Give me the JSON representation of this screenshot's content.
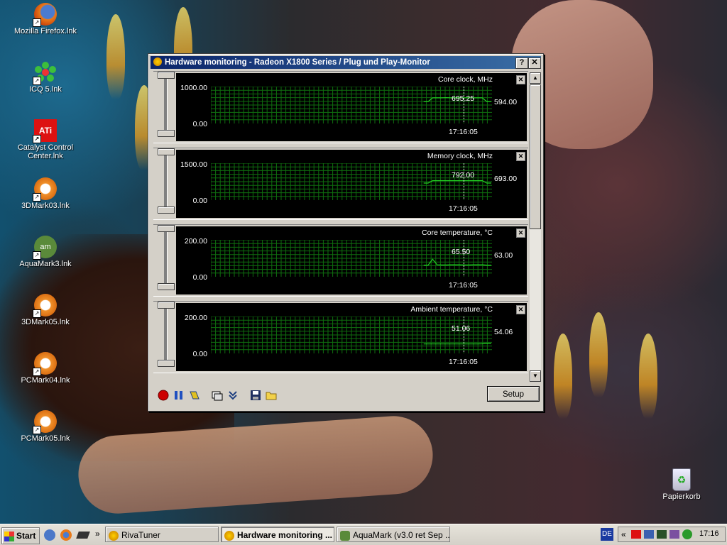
{
  "desktop": {
    "icons": [
      {
        "label": "Mozilla Firefox.lnk",
        "icon": "firefox-icon"
      },
      {
        "label": "ICQ 5.lnk",
        "icon": "icq-flower-icon"
      },
      {
        "label": "Catalyst Control Center.lnk",
        "icon": "ati-icon"
      },
      {
        "label": "3DMark03.lnk",
        "icon": "futuremark-icon"
      },
      {
        "label": "AquaMark3.lnk",
        "icon": "aquamark-icon"
      },
      {
        "label": "3DMark05.lnk",
        "icon": "futuremark-icon"
      },
      {
        "label": "PCMark04.lnk",
        "icon": "futuremark-icon"
      },
      {
        "label": "PCMark05.lnk",
        "icon": "futuremark-icon"
      }
    ],
    "recycle_bin": "Papierkorb"
  },
  "window": {
    "title": "Hardware monitoring - Radeon X1800 Series  / Plug und Play-Monitor",
    "help_label": "?",
    "close_label": "✕"
  },
  "graphs": [
    {
      "name": "Core clock, MHz",
      "max": "1000.00",
      "min": "0.00",
      "current": "695.25",
      "last": "594.00",
      "time": "17:16:05",
      "ymax": 1000,
      "series": [
        0,
        0,
        0,
        0,
        0,
        0,
        0,
        0,
        0,
        0,
        0,
        0,
        0,
        0,
        0,
        0,
        0,
        0,
        0,
        0,
        0,
        0,
        0,
        0,
        0,
        0,
        0,
        0,
        0,
        0,
        0,
        0,
        0,
        0,
        0,
        0,
        0,
        0,
        0,
        0,
        0,
        0,
        0,
        0,
        0,
        0,
        0,
        594,
        594,
        695,
        695,
        695,
        700,
        695,
        695,
        695,
        695,
        695,
        695,
        695,
        695,
        594,
        594
      ]
    },
    {
      "name": "Memory clock, MHz",
      "max": "1500.00",
      "min": "0.00",
      "current": "792.00",
      "last": "693.00",
      "time": "17:16:05",
      "ymax": 1500,
      "series": [
        0,
        0,
        0,
        0,
        0,
        0,
        0,
        0,
        0,
        0,
        0,
        0,
        0,
        0,
        0,
        0,
        0,
        0,
        0,
        0,
        0,
        0,
        0,
        0,
        0,
        0,
        0,
        0,
        0,
        0,
        0,
        0,
        0,
        0,
        0,
        0,
        0,
        0,
        0,
        0,
        0,
        0,
        0,
        0,
        0,
        0,
        0,
        693,
        693,
        792,
        792,
        792,
        792,
        792,
        792,
        792,
        792,
        792,
        792,
        792,
        792,
        693,
        693
      ]
    },
    {
      "name": "Core temperature, °C",
      "max": "200.00",
      "min": "0.00",
      "current": "65.50",
      "last": "63.00",
      "time": "17:16:05",
      "ymax": 200,
      "series": [
        0,
        0,
        0,
        0,
        0,
        0,
        0,
        0,
        0,
        0,
        0,
        0,
        0,
        0,
        0,
        0,
        0,
        0,
        0,
        0,
        0,
        0,
        0,
        0,
        0,
        0,
        0,
        0,
        0,
        0,
        0,
        0,
        0,
        0,
        0,
        0,
        0,
        0,
        0,
        0,
        0,
        0,
        0,
        0,
        0,
        0,
        0,
        63,
        63,
        95,
        65,
        64,
        64,
        65,
        65,
        65,
        64,
        64,
        65,
        65,
        65,
        63,
        63
      ]
    },
    {
      "name": "Ambient temperature, °C",
      "max": "200.00",
      "min": "0.00",
      "current": "51.06",
      "last": "54.06",
      "time": "17:16:05",
      "ymax": 200,
      "series": [
        0,
        0,
        0,
        0,
        0,
        0,
        0,
        0,
        0,
        0,
        0,
        0,
        0,
        0,
        0,
        0,
        0,
        0,
        0,
        0,
        0,
        0,
        0,
        0,
        0,
        0,
        0,
        0,
        0,
        0,
        0,
        0,
        0,
        0,
        0,
        0,
        0,
        0,
        0,
        0,
        0,
        0,
        0,
        0,
        0,
        0,
        0,
        51,
        51,
        51,
        51,
        51,
        51,
        51,
        51,
        51,
        51,
        51,
        51,
        51,
        52,
        54,
        54
      ]
    }
  ],
  "toolbar": {
    "setup_label": "Setup",
    "tools": [
      "record-icon",
      "pause-icon",
      "clear-icon",
      "window-icon",
      "collapse-icon",
      "save-icon",
      "open-folder-icon"
    ]
  },
  "taskbar": {
    "start_label": "Start",
    "quicklaunch_more": "»",
    "buttons": [
      {
        "label": "RivaTuner",
        "active": false
      },
      {
        "label": "Hardware monitoring ...",
        "active": true
      },
      {
        "label": "AquaMark (v3.0 ret Sep ...",
        "active": false
      }
    ],
    "language": "DE",
    "tray_more": "«",
    "clock": "17:16"
  },
  "colors": {
    "graph_line": "#22d022",
    "grid": "#0f6e0f",
    "title_bar": "#0a246a"
  }
}
